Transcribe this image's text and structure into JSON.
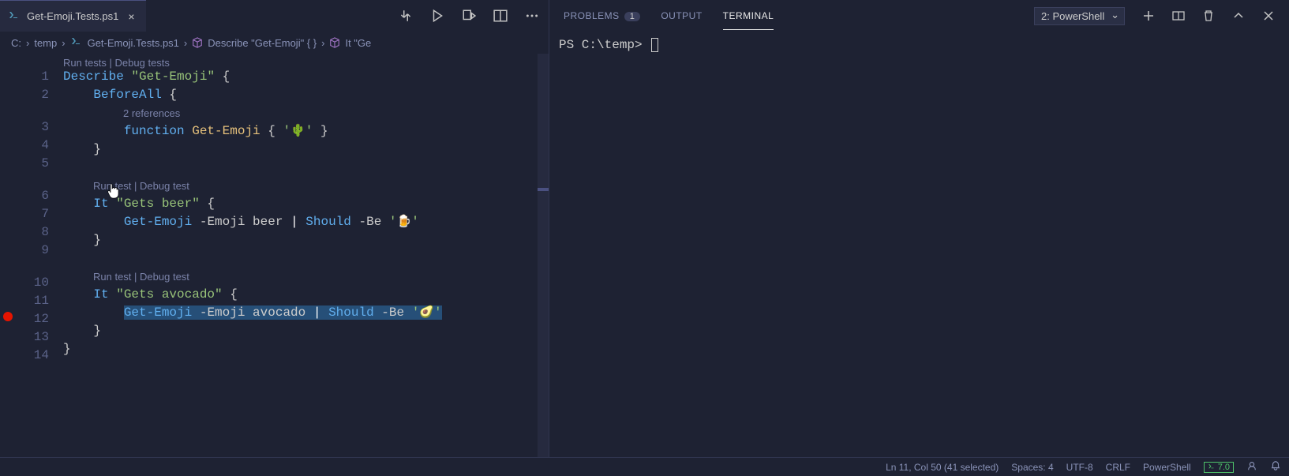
{
  "tab": {
    "filename": "Get-Emoji.Tests.ps1"
  },
  "breadcrumb": {
    "p1": "C:",
    "p2": "temp",
    "p3": "Get-Emoji.Tests.ps1",
    "p4": "Describe \"Get-Emoji\" { }",
    "p5": "It \"Ge"
  },
  "codelens": {
    "describe_run": "Run tests",
    "describe_debug": "Debug tests",
    "refs": "2 references",
    "it1_run": "Run test",
    "it1_debug": "Debug test",
    "it2_run": "Run test",
    "it2_debug": "Debug test"
  },
  "code": {
    "l1_describe": "Describe",
    "l1_str": "\"Get-Emoji\"",
    "l1_brace": " {",
    "l2_before": "BeforeAll",
    "l2_brace": " {",
    "l3_function": "function",
    "l3_name": " Get-Emoji ",
    "l3_open": "{ ",
    "l3_str1": "'",
    "l3_emoji": "🌵",
    "l3_str2": "'",
    "l3_close": " }",
    "l4_close": "}",
    "l6_it": "It",
    "l6_str": " \"Gets beer\"",
    "l6_brace": " {",
    "l7_cmd": "Get-Emoji",
    "l7_param": " -Emoji ",
    "l7_arg": "beer ",
    "l7_pipe": "|",
    "l7_should": " Should ",
    "l7_be": "-Be ",
    "l7_q1": "'",
    "l7_emoji": "🍺",
    "l7_q2": "'",
    "l8_close": "}",
    "l10_it": "It",
    "l10_str": " \"Gets avocado\"",
    "l10_brace": " {",
    "l11_cmd": "Get-Emoji",
    "l11_param": " -Emoji ",
    "l11_arg": "avocado ",
    "l11_pipe": "|",
    "l11_should": " Should ",
    "l11_be": "-Be ",
    "l11_q1": "'",
    "l11_emoji": "🥑",
    "l11_q2": "'",
    "l12_close": "}",
    "l13_close": "}"
  },
  "line_numbers": [
    "1",
    "2",
    "3",
    "4",
    "5",
    "6",
    "7",
    "8",
    "9",
    "10",
    "11",
    "12",
    "13",
    "14"
  ],
  "panel": {
    "tabs": {
      "problems": "PROBLEMS",
      "output": "OUTPUT",
      "terminal": "TERMINAL"
    },
    "problems_count": "1",
    "terminal_selector": "2: PowerShell"
  },
  "terminal": {
    "prompt": "PS C:\\temp> "
  },
  "status": {
    "position": "Ln 11, Col 50 (41 selected)",
    "spaces": "Spaces: 4",
    "encoding": "UTF-8",
    "eol": "CRLF",
    "lang": "PowerShell",
    "ps_version": "7.0"
  }
}
